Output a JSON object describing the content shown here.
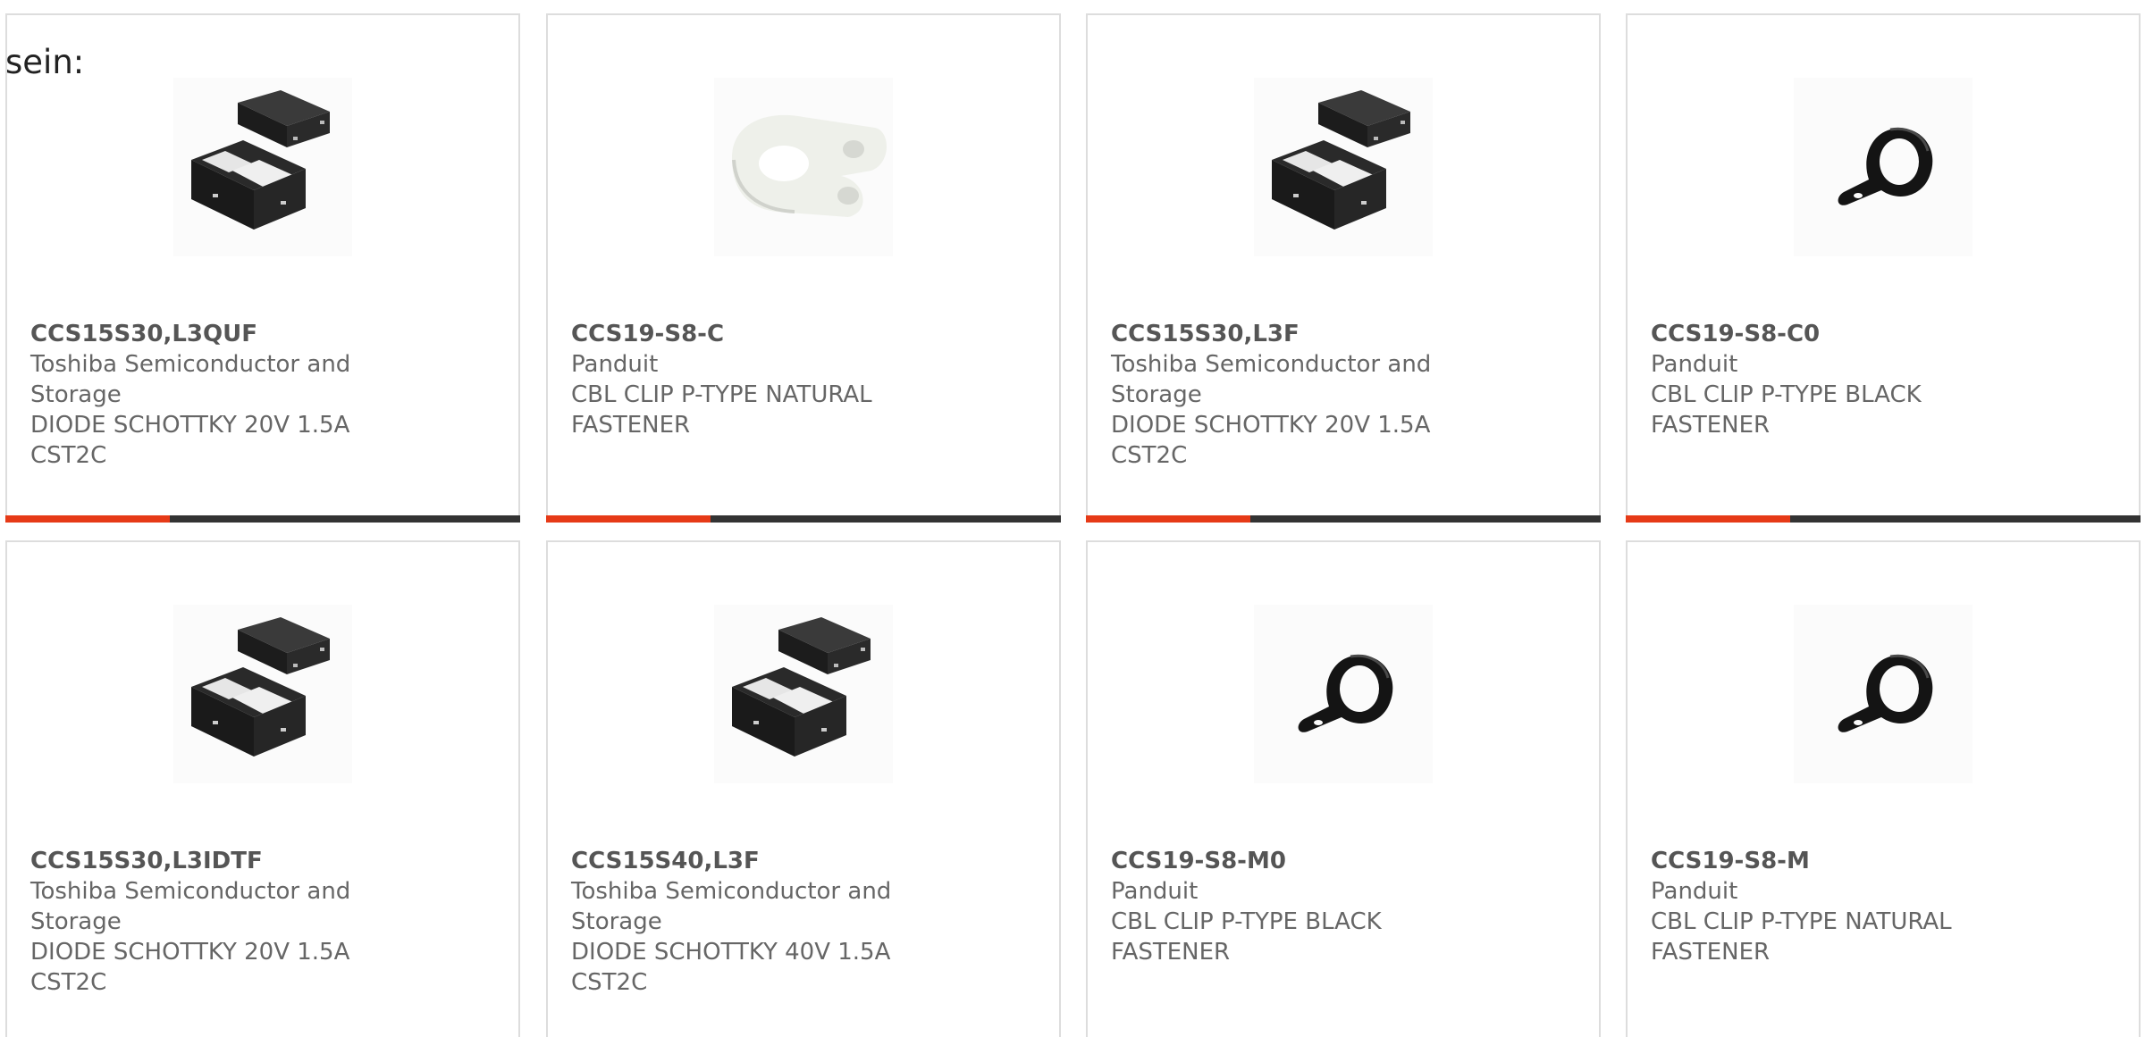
{
  "intro_text": "sein:",
  "accent_color": "#e63a17",
  "bar_color": "#333333",
  "products": [
    {
      "part_number": "CCS15S30,L3QUF",
      "manufacturer": "Toshiba Semiconductor and Storage",
      "description": "DIODE SCHOTTKY 20V 1.5A CST2C",
      "image": "diode-package-image"
    },
    {
      "part_number": "CCS19-S8-C",
      "manufacturer": "Panduit",
      "description": "CBL CLIP P-TYPE NATURAL FASTENER",
      "image": "natural-cable-clip-image"
    },
    {
      "part_number": "CCS15S30,L3F",
      "manufacturer": "Toshiba Semiconductor and Storage",
      "description": "DIODE SCHOTTKY 20V 1.5A CST2C",
      "image": "diode-package-image"
    },
    {
      "part_number": "CCS19-S8-C0",
      "manufacturer": "Panduit",
      "description": "CBL CLIP P-TYPE BLACK FASTENER",
      "image": "black-cable-clip-image"
    },
    {
      "part_number": "CCS15S30,L3IDTF",
      "manufacturer": "Toshiba Semiconductor and Storage",
      "description": "DIODE SCHOTTKY 20V 1.5A CST2C",
      "image": "diode-package-image"
    },
    {
      "part_number": "CCS15S40,L3F",
      "manufacturer": "Toshiba Semiconductor and Storage",
      "description": "DIODE SCHOTTKY 40V 1.5A CST2C",
      "image": "diode-package-image"
    },
    {
      "part_number": "CCS19-S8-M0",
      "manufacturer": "Panduit",
      "description": "CBL CLIP P-TYPE BLACK FASTENER",
      "image": "black-cable-clip-image"
    },
    {
      "part_number": "CCS19-S8-M",
      "manufacturer": "Panduit",
      "description": "CBL CLIP P-TYPE NATURAL FASTENER",
      "image": "black-cable-clip-image"
    }
  ]
}
